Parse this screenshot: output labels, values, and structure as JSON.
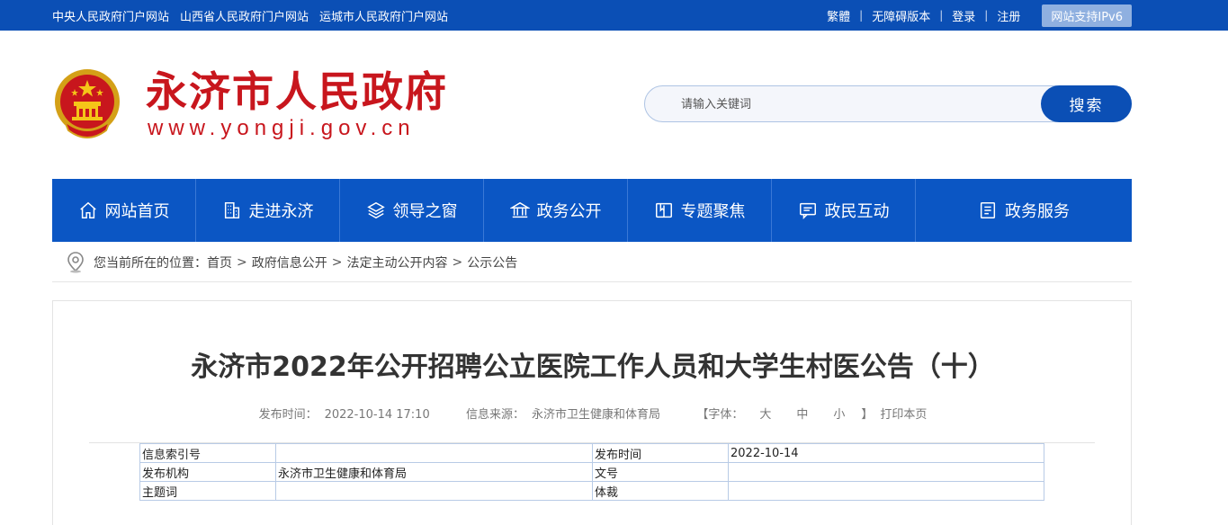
{
  "topbar": {
    "links": [
      "中央人民政府门户网站",
      "山西省人民政府门户网站",
      "运城市人民政府门户网站"
    ],
    "right": [
      "繁體",
      "无障碍版本",
      "登录",
      "注册"
    ],
    "ipv6": "网站支持IPv6"
  },
  "header": {
    "title": "永济市人民政府",
    "url": "www.yongji.gov.cn"
  },
  "search": {
    "placeholder": "请输入关键词",
    "button": "搜索"
  },
  "nav": {
    "items": [
      {
        "label": "网站首页",
        "icon": "home-icon"
      },
      {
        "label": "走进永济",
        "icon": "building-icon"
      },
      {
        "label": "领导之窗",
        "icon": "layers-icon"
      },
      {
        "label": "政务公开",
        "icon": "government-icon"
      },
      {
        "label": "专题聚焦",
        "icon": "book-icon"
      },
      {
        "label": "政民互动",
        "icon": "chat-icon"
      },
      {
        "label": "政务服务",
        "icon": "document-icon"
      }
    ]
  },
  "breadcrumb": {
    "prefix": "您当前所在的位置：",
    "crumbs": [
      "首页",
      "政府信息公开",
      "法定主动公开内容",
      "公示公告"
    ]
  },
  "article": {
    "title": "永济市2022年公开招聘公立医院工作人员和大学生村医公告（十）",
    "publish_label": "发布时间：",
    "publish_time": "2022-10-14 17:10",
    "source_label": "信息来源：",
    "source": "永济市卫生健康和体育局",
    "font_label_open": "【字体：",
    "font_large": "大",
    "font_medium": "中",
    "font_small": "小",
    "font_label_close": "】",
    "print": "打印本页"
  },
  "info_table": {
    "rows": [
      {
        "k1": "信息索引号",
        "v1": "",
        "k2": "发布时间",
        "v2": "2022-10-14"
      },
      {
        "k1": "发布机构",
        "v1": "永济市卫生健康和体育局",
        "k2": "文号",
        "v2": ""
      },
      {
        "k1": "主题词",
        "v1": "",
        "k2": "体裁",
        "v2": ""
      }
    ]
  }
}
